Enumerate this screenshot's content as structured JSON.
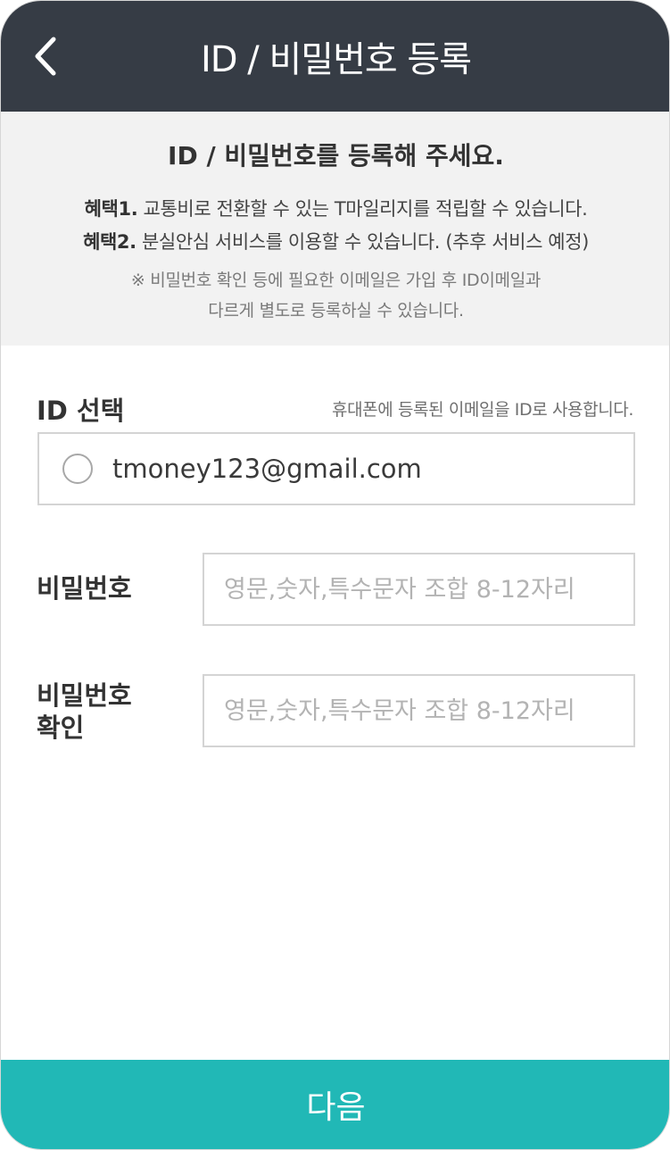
{
  "header": {
    "title": "ID / 비밀번호 등록"
  },
  "info": {
    "title": "ID / 비밀번호를 등록해 주세요.",
    "benefit1_label": "혜택1.",
    "benefit1_text": " 교통비로 전환할 수 있는 T마일리지를 적립할 수 있습니다.",
    "benefit2_label": "혜택2.",
    "benefit2_text": " 분실안심 서비스를 이용할 수 있습니다. (추후 서비스 예정)",
    "note_line1": "※ 비밀번호 확인 등에 필요한 이메일은 가입 후 ID이메일과",
    "note_line2": "다르게 별도로 등록하실 수 있습니다."
  },
  "id_section": {
    "label": "ID 선택",
    "hint": "휴대폰에 등록된 이메일을 ID로 사용합니다.",
    "email": "tmoney123@gmail.com",
    "selected": false
  },
  "password": {
    "label": "비밀번호",
    "value": "",
    "placeholder": "영문,숫자,특수문자 조합 8-12자리"
  },
  "password_confirm": {
    "label_line1": "비밀번호",
    "label_line2": "확인",
    "value": "",
    "placeholder": "영문,숫자,특수문자 조합 8-12자리"
  },
  "footer": {
    "next_label": "다음"
  },
  "colors": {
    "header_bg": "#363c45",
    "info_bg": "#f2f2f2",
    "accent": "#21b8b6"
  },
  "icons": {
    "back": "chevron-left-icon",
    "radio": "radio-unchecked-icon"
  }
}
